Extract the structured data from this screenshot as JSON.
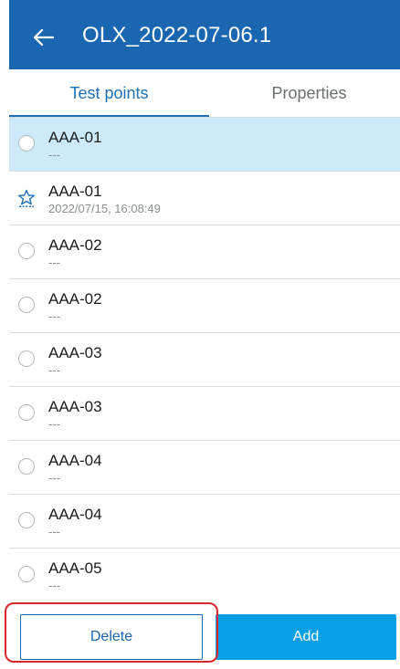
{
  "header": {
    "back_icon": "arrow-left-icon",
    "title": "OLX_2022-07-06.1"
  },
  "tabs": [
    {
      "label": "Test points",
      "active": true
    },
    {
      "label": "Properties",
      "active": false
    }
  ],
  "list": {
    "items": [
      {
        "title": "AAA-01",
        "subtitle": "---",
        "icon": "radio-icon",
        "selected": true
      },
      {
        "title": "AAA-01",
        "subtitle": "2022/07/15, 16:08:49",
        "icon": "star-outline-icon",
        "selected": false
      },
      {
        "title": "AAA-02",
        "subtitle": "---",
        "icon": "radio-icon",
        "selected": false
      },
      {
        "title": "AAA-02",
        "subtitle": "---",
        "icon": "radio-icon",
        "selected": false
      },
      {
        "title": "AAA-03",
        "subtitle": "---",
        "icon": "radio-icon",
        "selected": false
      },
      {
        "title": "AAA-03",
        "subtitle": "---",
        "icon": "radio-icon",
        "selected": false
      },
      {
        "title": "AAA-04",
        "subtitle": "---",
        "icon": "radio-icon",
        "selected": false
      },
      {
        "title": "AAA-04",
        "subtitle": "---",
        "icon": "radio-icon",
        "selected": false
      },
      {
        "title": "AAA-05",
        "subtitle": "---",
        "icon": "radio-icon",
        "selected": false
      }
    ]
  },
  "footer": {
    "delete_label": "Delete",
    "add_label": "Add"
  },
  "colors": {
    "header_bg": "#1a66b0",
    "selected_row_bg": "#cdeafa",
    "add_button_bg": "#0b9fe6",
    "highlight_border": "#d9282b"
  }
}
